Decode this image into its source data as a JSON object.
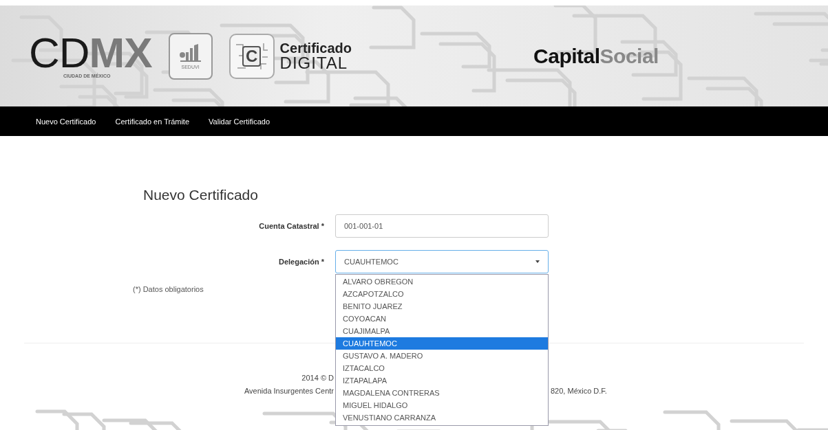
{
  "header": {
    "cdmx_logo": {
      "light": "CD",
      "bold": "MX",
      "subtitle": "CIUDAD DE MÉXICO"
    },
    "seduvi_logo": {
      "label": "SEDUVI"
    },
    "certificado_logo": {
      "mark": "C",
      "title": "Certificado",
      "subtitle": "DIGITAL"
    },
    "capital_social_logo": {
      "bold": "Capital",
      "light": "Social"
    }
  },
  "nav": [
    {
      "label": "Nuevo Certificado"
    },
    {
      "label": "Certificado en Trámite"
    },
    {
      "label": "Validar Certificado"
    }
  ],
  "form": {
    "title": "Nuevo Certificado",
    "fields": [
      {
        "kind": "text",
        "label": "Cuenta Catastral *",
        "value": "001-001-01"
      },
      {
        "kind": "select",
        "label": "Delegación *",
        "value": "CUAUHTEMOC",
        "expanded": true,
        "options": [
          {
            "label": "ALVARO OBREGON",
            "selected": false
          },
          {
            "label": "AZCAPOTZALCO",
            "selected": false
          },
          {
            "label": "BENITO JUAREZ",
            "selected": false
          },
          {
            "label": "COYOACAN",
            "selected": false
          },
          {
            "label": "CUAJIMALPA",
            "selected": false
          },
          {
            "label": "CUAUHTEMOC",
            "selected": true
          },
          {
            "label": "GUSTAVO A. MADERO",
            "selected": false
          },
          {
            "label": "IZTACALCO",
            "selected": false
          },
          {
            "label": "IZTAPALAPA",
            "selected": false
          },
          {
            "label": "MAGDALENA CONTRERAS",
            "selected": false
          },
          {
            "label": "MIGUEL HIDALGO",
            "selected": false
          },
          {
            "label": "VENUSTIANO CARRANZA",
            "selected": false
          }
        ]
      }
    ],
    "note": "(*) Datos obligatorios"
  },
  "footer": {
    "line_1": "2014 © D",
    "line_2_left": "Avenida Insurgentes Centr",
    "line_2_right": "820, México D.F."
  }
}
